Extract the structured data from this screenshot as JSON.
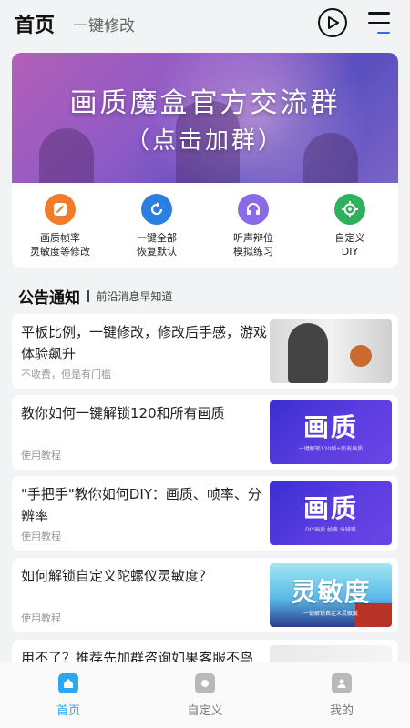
{
  "header": {
    "title": "首页",
    "subtitle": "一键修改"
  },
  "banner": {
    "line1": "画质魔盒官方交流群",
    "line2": "（点击加群）"
  },
  "tools": [
    {
      "label1": "画质帧率",
      "label2": "灵敏度等修改",
      "color": "#f07c2c",
      "icon": "edit-icon"
    },
    {
      "label1": "一键全部",
      "label2": "恢复默认",
      "color": "#2b7fe0",
      "icon": "refresh-icon"
    },
    {
      "label1": "听声辩位",
      "label2": "模拟练习",
      "color": "#8a6ae6",
      "icon": "headphones-icon"
    },
    {
      "label1": "自定义",
      "label2": "DIY",
      "color": "#2fb05e",
      "icon": "crosshair-icon"
    }
  ],
  "section": {
    "title": "公告通知",
    "desc": "前沿消息早知道"
  },
  "articles": [
    {
      "title": "平板比例，一键修改，修改后手感，游戏体验飙升",
      "meta": "不收费，但是有门槛"
    },
    {
      "title": "教你如何一键解锁120和所有画质",
      "meta": "使用教程",
      "thumb_big": "画质",
      "thumb_small": "一键解锁120帧+所有画质"
    },
    {
      "title": "\"手把手\"教你如何DIY：画质、帧率、分辨率",
      "meta": "使用教程",
      "thumb_big": "画质",
      "thumb_small": "DIY画质  帧率  分辨率"
    },
    {
      "title": "如何解锁自定义陀螺仪灵敏度？",
      "meta": "使用教程",
      "thumb_big": "灵敏度",
      "thumb_small": "一键解锁自定义灵敏度"
    },
    {
      "title": "用不了？推荐先加群咨询如果客服不鸟"
    }
  ],
  "tabs": [
    {
      "label": "首页"
    },
    {
      "label": "自定义"
    },
    {
      "label": "我的"
    }
  ],
  "colors": {
    "accent": "#2fa6f2",
    "background": "#f2f3f5"
  }
}
